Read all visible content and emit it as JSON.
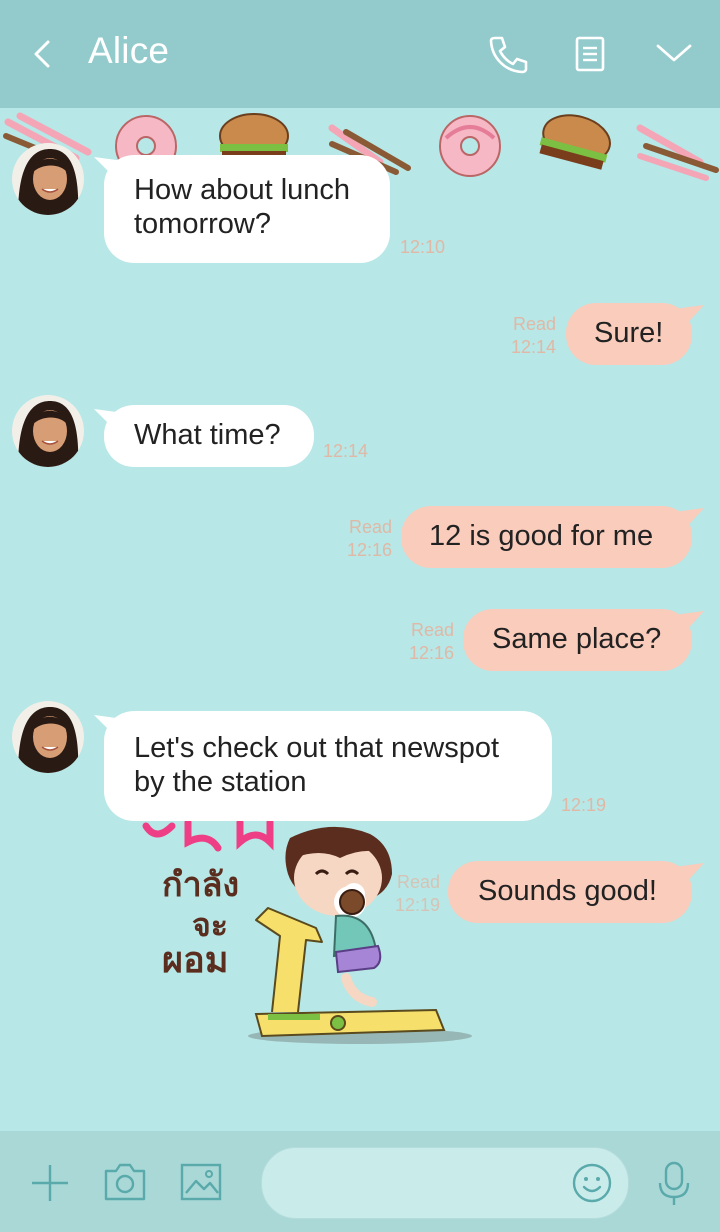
{
  "header": {
    "title": "Alice",
    "back_icon": "chevron-left-icon",
    "call_icon": "phone-icon",
    "notes_icon": "document-icon",
    "menu_icon": "chevron-down-icon"
  },
  "messages": [
    {
      "id": 1,
      "side": "in",
      "text": "How about lunch\ntomorrow?",
      "time": "12:10"
    },
    {
      "id": 2,
      "side": "out",
      "text": "Sure!",
      "read": "Read",
      "time": "12:14"
    },
    {
      "id": 3,
      "side": "in",
      "text": "What time?",
      "time": "12:14"
    },
    {
      "id": 4,
      "side": "out",
      "text": "12 is good for me",
      "read": "Read",
      "time": "12:16"
    },
    {
      "id": 5,
      "side": "out",
      "text": "Same place?",
      "read": "Read",
      "time": "12:16"
    },
    {
      "id": 6,
      "side": "in",
      "text": "Let's check out that newspot\nby the station",
      "time": "12:19"
    },
    {
      "id": 7,
      "side": "out",
      "text": "Sounds good!",
      "read": "Read",
      "time": "12:19"
    }
  ],
  "sticker": {
    "text_line1": "กำลัง",
    "text_line2": "จะ",
    "text_line3": "ผอม"
  },
  "composer": {
    "placeholder": "",
    "add_icon": "plus-icon",
    "camera_icon": "camera-icon",
    "gallery_icon": "image-icon",
    "emoji_icon": "smiley-icon",
    "mic_icon": "microphone-icon"
  },
  "colors": {
    "header_bg": "#93cbcc",
    "chat_bg": "#b7e7e6",
    "incoming_bubble": "#ffffff",
    "outgoing_bubble": "#f9ccbc",
    "timestamp": "#e0b8a6",
    "bottom_bar": "#a9d8d7",
    "icon": "#5aa9ab"
  }
}
